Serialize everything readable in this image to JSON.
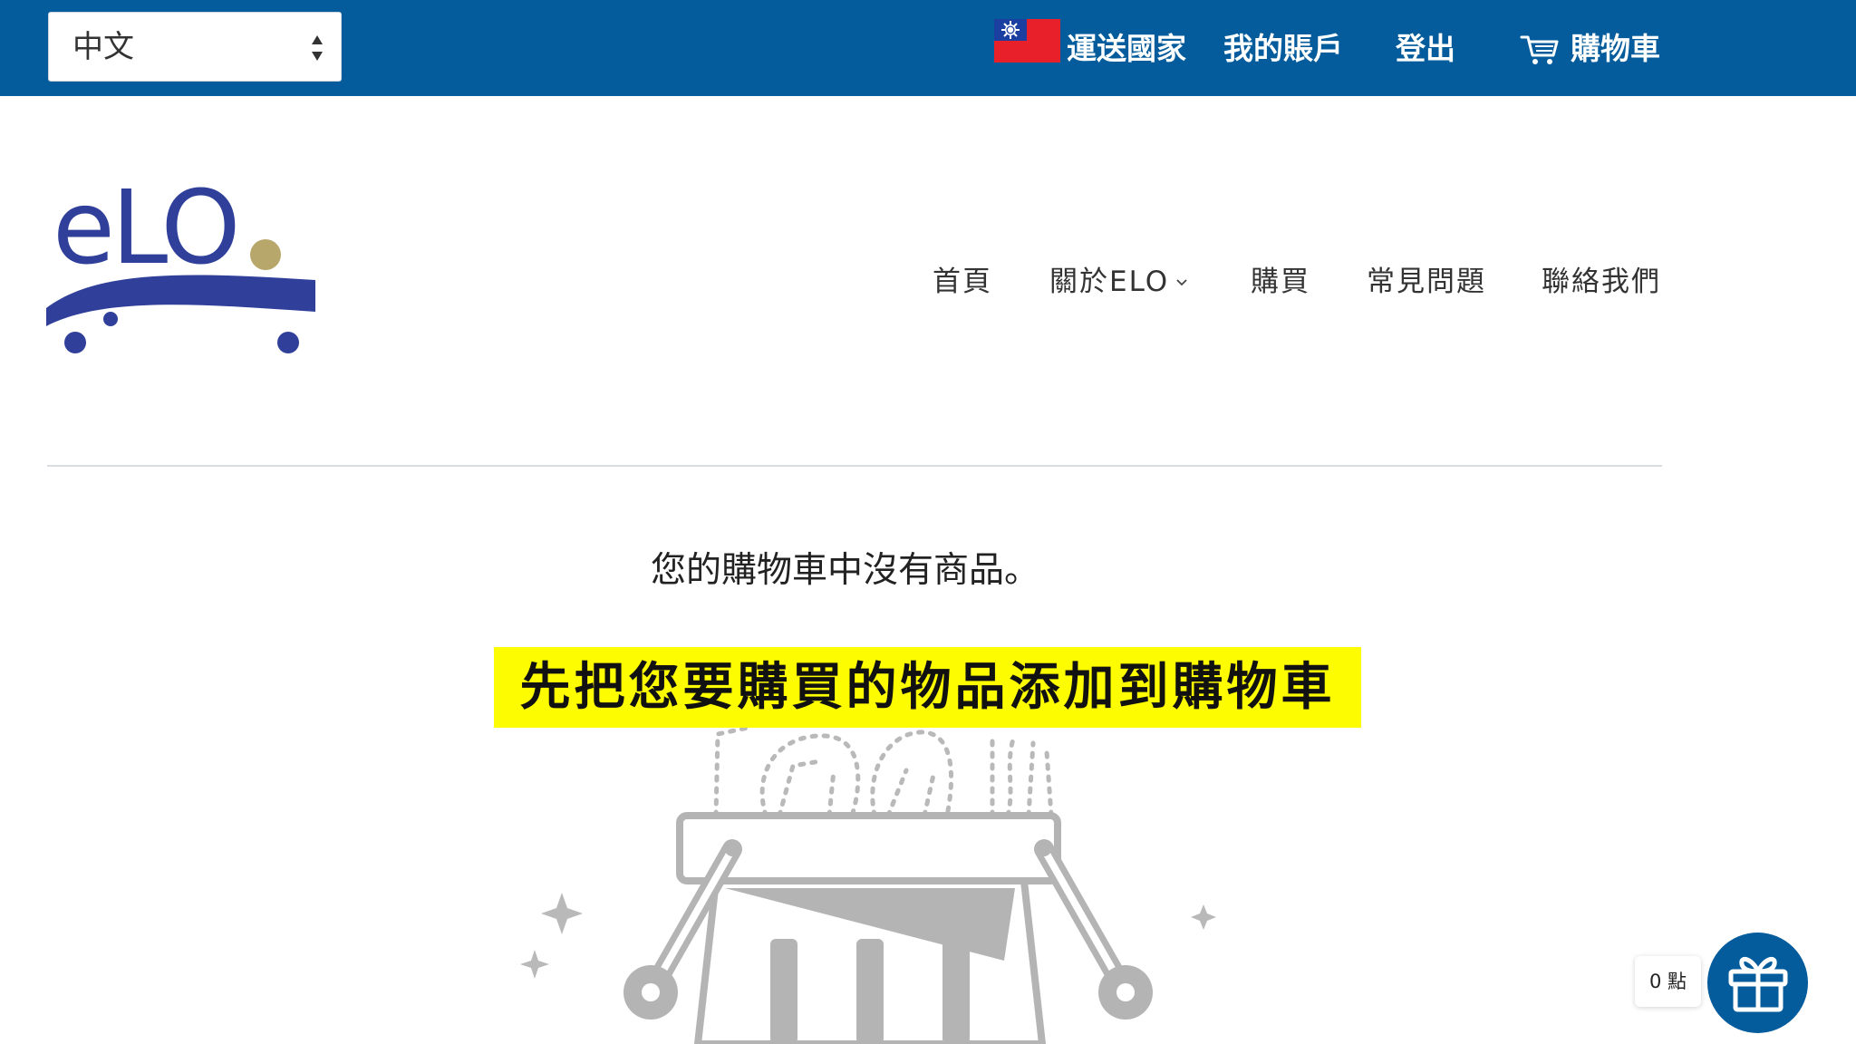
{
  "topbar": {
    "language_select": {
      "value": "中文"
    },
    "shipping_country_label": "運送國家",
    "my_account_label": "我的賬戶",
    "logout_label": "登出",
    "cart_label": "購物車",
    "background_color": "#045c9c"
  },
  "logo": {
    "text": "eLO",
    "colors": {
      "primary": "#30409a",
      "dot": "#b8a76a"
    }
  },
  "main_nav": {
    "items": [
      {
        "label": "首頁"
      },
      {
        "label": "關於ELO",
        "has_dropdown": true
      },
      {
        "label": "購買"
      },
      {
        "label": "常見問題"
      },
      {
        "label": "聯絡我們"
      }
    ]
  },
  "cart_page": {
    "empty_message": "您的購物車中沒有商品。",
    "caption": "先把您要購買的物品添加到購物車"
  },
  "rewards": {
    "points_label": "0 點",
    "accent_color": "#045c9c"
  }
}
